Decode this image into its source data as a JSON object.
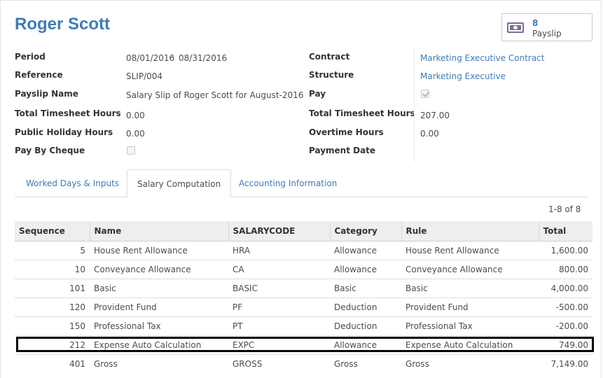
{
  "employee_name": "Roger Scott",
  "smart_button": {
    "count": "8",
    "label": "Payslip",
    "icon": "money-icon"
  },
  "left_fields": [
    {
      "label": "Period",
      "value": "08/01/2016",
      "value_end": "08/31/2016",
      "separator": "-"
    },
    {
      "label": "Reference",
      "value": "SLIP/004"
    },
    {
      "label": "Payslip Name",
      "value": "Salary Slip of Roger Scott for August-2016"
    },
    {
      "label": "Total Timesheet Hours",
      "value": "0.00"
    },
    {
      "label": "Public Holiday Hours",
      "value": "0.00"
    },
    {
      "label": "Pay By Cheque",
      "checked": false
    }
  ],
  "right_fields": [
    {
      "label": "Contract",
      "value": "Marketing Executive Contract"
    },
    {
      "label": "Structure",
      "value": "Marketing Executive"
    },
    {
      "label": "Pay",
      "checked": true
    },
    {
      "label": "Total Timesheet Hours",
      "value": "207.00"
    },
    {
      "label": "Overtime Hours",
      "value": "0.00"
    },
    {
      "label": "Payment Date",
      "value": ""
    }
  ],
  "tabs": [
    {
      "label": "Worked Days & Inputs",
      "active": false
    },
    {
      "label": "Salary Computation",
      "active": true
    },
    {
      "label": "Accounting Information",
      "active": false
    }
  ],
  "pager": "1-8 of 8",
  "table": {
    "columns": [
      "Sequence",
      "Name",
      "SALARYCODE",
      "Category",
      "Rule",
      "Total"
    ],
    "rows": [
      {
        "sequence": "5",
        "name": "House Rent Allowance",
        "code": "HRA",
        "category": "Allowance",
        "rule": "House Rent Allowance",
        "total": "1,600.00"
      },
      {
        "sequence": "10",
        "name": "Conveyance Allowance",
        "code": "CA",
        "category": "Allowance",
        "rule": "Conveyance Allowance",
        "total": "800.00"
      },
      {
        "sequence": "101",
        "name": "Basic",
        "code": "BASIC",
        "category": "Basic",
        "rule": "Basic",
        "total": "4,000.00"
      },
      {
        "sequence": "120",
        "name": "Provident Fund",
        "code": "PF",
        "category": "Deduction",
        "rule": "Provident Fund",
        "total": "-500.00"
      },
      {
        "sequence": "150",
        "name": "Professional Tax",
        "code": "PT",
        "category": "Deduction",
        "rule": "Professional Tax",
        "total": "-200.00"
      },
      {
        "sequence": "212",
        "name": "Expense Auto Calculation",
        "code": "EXPC",
        "category": "Allowance",
        "rule": "Expense Auto Calculation",
        "total": "749.00"
      },
      {
        "sequence": "401",
        "name": "Gross",
        "code": "GROSS",
        "category": "Gross",
        "rule": "Gross",
        "total": "7,149.00"
      }
    ]
  },
  "colors": {
    "link": "#3e7cb7",
    "money_icon": "#7f6a96",
    "highlight_border": "#000000"
  }
}
